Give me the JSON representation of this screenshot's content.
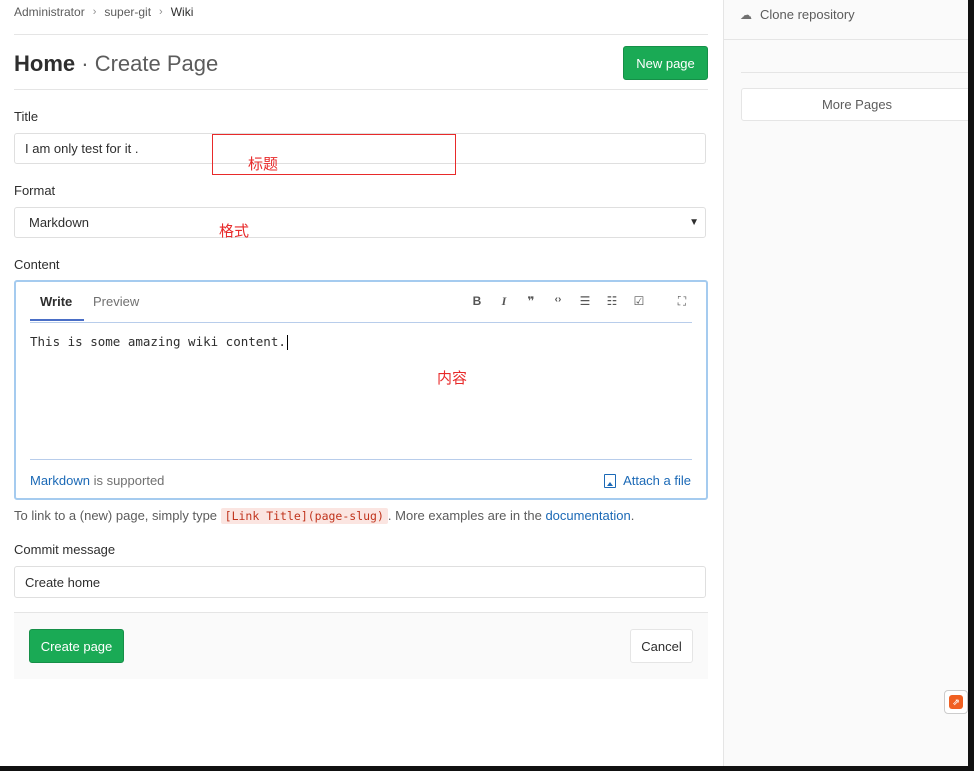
{
  "breadcrumb": {
    "items": [
      "Administrator",
      "super-git",
      "Wiki"
    ],
    "separator": "›"
  },
  "header": {
    "title_main": "Home",
    "title_sub": "· Create Page",
    "new_page_label": "New page"
  },
  "form": {
    "title_label": "Title",
    "title_value": "I am only test for it .",
    "format_label": "Format",
    "format_value": "Markdown",
    "content_label": "Content",
    "commit_label": "Commit message",
    "commit_value": "Create home"
  },
  "editor": {
    "tabs": [
      "Write",
      "Preview"
    ],
    "toolbar_icons": [
      "bold-icon",
      "italic-icon",
      "quote-icon",
      "code-icon",
      "bullet-list-icon",
      "numbered-list-icon",
      "task-list-icon",
      "fullscreen-icon"
    ],
    "toolbar_glyphs": [
      "B",
      "I",
      "❞",
      "‹›",
      "☰",
      "☷",
      "☑",
      "⛶"
    ],
    "content": "This is some amazing wiki content.",
    "markdown_link": "Markdown",
    "supported_text": " is supported",
    "attach_label": "Attach a file"
  },
  "help": {
    "prefix": "To link to a (new) page, simply type ",
    "code": "[Link Title](page-slug)",
    "middle": ". More examples are in the ",
    "link": "documentation",
    "suffix": "."
  },
  "actions": {
    "create_label": "Create page",
    "cancel_label": "Cancel"
  },
  "sidebar": {
    "clone_label": "Clone repository",
    "more_pages_label": "More Pages"
  },
  "annotations": {
    "title": "标题",
    "format": "格式",
    "content": "内容"
  },
  "colors": {
    "primary_green": "#1aaa55",
    "link_blue": "#1b69b6",
    "annotation_red": "#e82a2a",
    "editor_focus": "#a5cbef"
  }
}
